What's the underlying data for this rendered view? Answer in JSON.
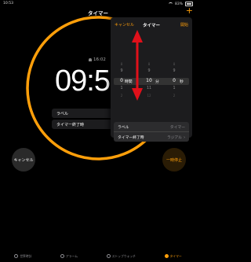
{
  "status": {
    "time": "10:53",
    "battery": "83%"
  },
  "nav": {
    "title": "タイマー"
  },
  "timer": {
    "countdown": "09:5",
    "alarm_time": "16:02"
  },
  "buttons": {
    "cancel": "キャンセル",
    "pause": "一時停止"
  },
  "underlay_list": [
    {
      "label": "ラベル"
    },
    {
      "label": "タイマー終了時"
    }
  ],
  "panel": {
    "cancel": "キャンセル",
    "title": "タイマー",
    "start": "開始",
    "picker": {
      "hours": [
        "8",
        "9",
        "0",
        "1",
        "2"
      ],
      "minutes": [
        "8",
        "9",
        "10",
        "11",
        "12"
      ],
      "seconds": [
        "8",
        "9",
        "0",
        "1",
        "2"
      ],
      "hours_label": "時間",
      "minutes_label": "分",
      "seconds_label": "秒"
    },
    "label_row": {
      "label": "ラベル",
      "value": "タイマー"
    },
    "sound_row": {
      "label": "タイマー終了時",
      "value": "ラジアル"
    }
  },
  "tabs": [
    {
      "label": "世界時計",
      "icon": "globe-icon"
    },
    {
      "label": "アラーム",
      "icon": "alarm-icon"
    },
    {
      "label": "ストップウォッチ",
      "icon": "stopwatch-icon"
    },
    {
      "label": "タイマー",
      "icon": "timer-icon",
      "active": true
    }
  ],
  "colors": {
    "accent": "#ff9f0a",
    "arrow": "#e0101a",
    "background": "#000000",
    "panel": "#1c1c1e"
  }
}
